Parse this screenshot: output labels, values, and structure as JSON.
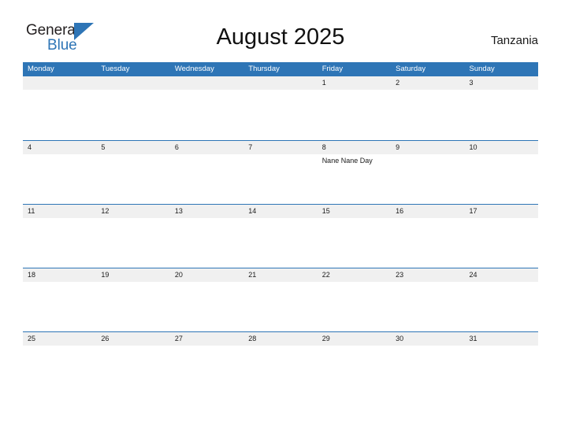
{
  "brand": {
    "word_one": "General",
    "word_two": "Blue",
    "accent_color": "#2e75b6",
    "text_color": "#231f20"
  },
  "header": {
    "title": "August 2025",
    "region": "Tanzania"
  },
  "calendar": {
    "header_bg": "#2e75b6",
    "band_bg": "#f0f0f0",
    "rule_color": "#2e75b6",
    "weekdays": [
      "Monday",
      "Tuesday",
      "Wednesday",
      "Thursday",
      "Friday",
      "Saturday",
      "Sunday"
    ],
    "weeks": [
      [
        {
          "date": "",
          "events": []
        },
        {
          "date": "",
          "events": []
        },
        {
          "date": "",
          "events": []
        },
        {
          "date": "",
          "events": []
        },
        {
          "date": "1",
          "events": []
        },
        {
          "date": "2",
          "events": []
        },
        {
          "date": "3",
          "events": []
        }
      ],
      [
        {
          "date": "4",
          "events": []
        },
        {
          "date": "5",
          "events": []
        },
        {
          "date": "6",
          "events": []
        },
        {
          "date": "7",
          "events": []
        },
        {
          "date": "8",
          "events": [
            "Nane Nane Day"
          ]
        },
        {
          "date": "9",
          "events": []
        },
        {
          "date": "10",
          "events": []
        }
      ],
      [
        {
          "date": "11",
          "events": []
        },
        {
          "date": "12",
          "events": []
        },
        {
          "date": "13",
          "events": []
        },
        {
          "date": "14",
          "events": []
        },
        {
          "date": "15",
          "events": []
        },
        {
          "date": "16",
          "events": []
        },
        {
          "date": "17",
          "events": []
        }
      ],
      [
        {
          "date": "18",
          "events": []
        },
        {
          "date": "19",
          "events": []
        },
        {
          "date": "20",
          "events": []
        },
        {
          "date": "21",
          "events": []
        },
        {
          "date": "22",
          "events": []
        },
        {
          "date": "23",
          "events": []
        },
        {
          "date": "24",
          "events": []
        }
      ],
      [
        {
          "date": "25",
          "events": []
        },
        {
          "date": "26",
          "events": []
        },
        {
          "date": "27",
          "events": []
        },
        {
          "date": "28",
          "events": []
        },
        {
          "date": "29",
          "events": []
        },
        {
          "date": "30",
          "events": []
        },
        {
          "date": "31",
          "events": []
        }
      ]
    ]
  }
}
